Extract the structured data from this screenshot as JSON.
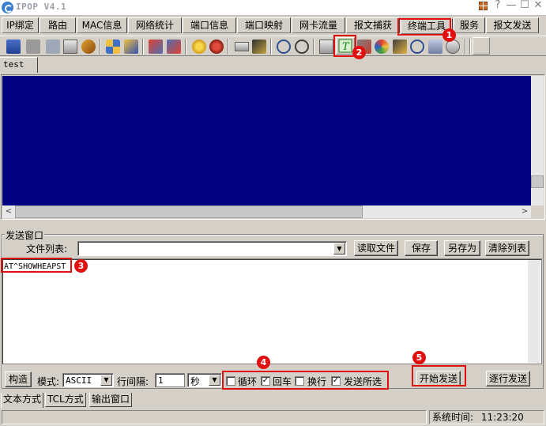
{
  "window": {
    "title": "IPOP V4.1",
    "controls": {
      "help": "?",
      "minimize": "—",
      "maximize": "☐",
      "close": "✕"
    }
  },
  "menu": {
    "tabs": [
      "IP绑定",
      "路由",
      "MAC信息",
      "网络统计",
      "端口信息",
      "端口映射",
      "网卡流量",
      "报文捕获",
      "终端工具",
      "服务",
      "报文发送"
    ],
    "active_tab": "终端工具"
  },
  "toolbar": {
    "icons": [
      "connect-icon",
      "disconnect-icon",
      "cut-icon",
      "copy-icon",
      "hand-icon",
      "properties-icon",
      "tools-icon",
      "send-file-icon",
      "receive-file-icon",
      "light-icon",
      "record-icon",
      "keyboard-icon",
      "run-icon",
      "zoom-icon",
      "target-icon",
      "calculator-icon",
      "terminal-text-icon",
      "settings-icon",
      "color-wheel-icon",
      "pen-icon",
      "find-icon",
      "erase-icon",
      "help-icon"
    ],
    "highlighted": "terminal-text-icon"
  },
  "session": {
    "tab_label": "test"
  },
  "send": {
    "group_title": "发送窗口",
    "file_list_label": "文件列表:",
    "file_list_value": "",
    "buttons": {
      "read_file": "读取文件",
      "save": "保存",
      "save_as": "另存为",
      "clear_list": "清除列表"
    },
    "content": "AT^SHOWHEAPST",
    "construct_button": "构造",
    "mode_label": "模式:",
    "mode_value": "ASCII",
    "interval_label": "行间隔:",
    "interval_value": "1",
    "interval_unit": "秒",
    "options": [
      {
        "label": "循环",
        "checked": false
      },
      {
        "label": "回车",
        "checked": true
      },
      {
        "label": "换行",
        "checked": false
      },
      {
        "label": "发送所选",
        "checked": true
      }
    ],
    "start_button": "开始发送",
    "step_button": "逐行发送"
  },
  "bottom_tabs": [
    "文本方式",
    "TCL方式",
    "输出窗口"
  ],
  "status": {
    "label": "系统时间:",
    "time": "11:23:20"
  },
  "annotations": [
    "1",
    "2",
    "3",
    "4",
    "5"
  ],
  "colors": {
    "terminal_bg": "#000080",
    "annotation": "#e01010"
  }
}
